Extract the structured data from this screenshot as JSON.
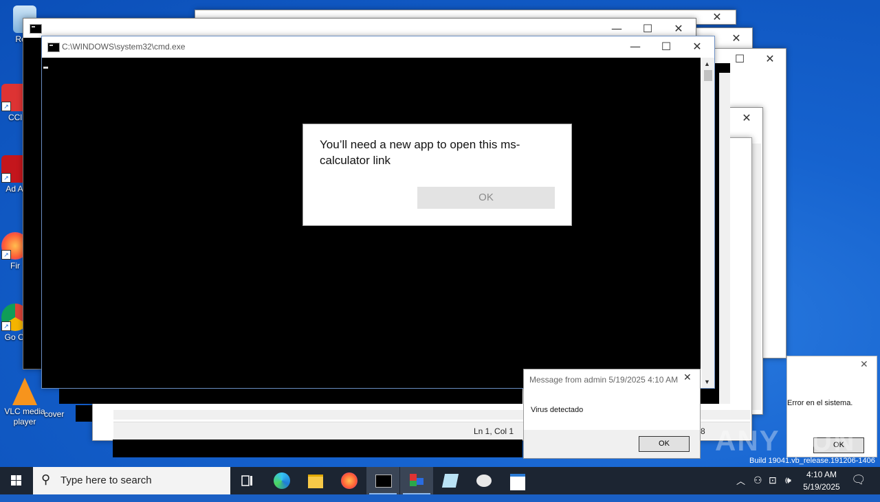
{
  "desktop": {
    "icons": [
      {
        "label": "Recy"
      },
      {
        "label": "CCl"
      },
      {
        "label": "Ad Acr"
      },
      {
        "label": "Fir"
      },
      {
        "label": "Go Chr"
      },
      {
        "label": "VLC media player"
      },
      {
        "label": "cover"
      }
    ],
    "build_text": "Build 19041.vb_release.191206-1406"
  },
  "cmd_window": {
    "title": "C:\\WINDOWS\\system32\\cmd.exe"
  },
  "app_dialog": {
    "message": "You’ll need a new app to open this ms-calculator link",
    "ok_label": "OK"
  },
  "notepad": {
    "status_position": "Ln 1, Col 1",
    "status_partial": "8"
  },
  "msgbox": {
    "title": "Message from admin 5/19/2025 4:10 AM",
    "body": "Virus detectado",
    "ok_label": "OK"
  },
  "errbox": {
    "text": "Error en el sistema.",
    "ok_label": "OK"
  },
  "taskbar": {
    "search_placeholder": "Type here to search",
    "time": "4:10 AM",
    "date": "5/19/2025"
  },
  "watermark": "ANY RUN",
  "colors": {
    "desktop_blue": "#1663cf",
    "taskbar": "#1c2532",
    "console": "#000000"
  }
}
